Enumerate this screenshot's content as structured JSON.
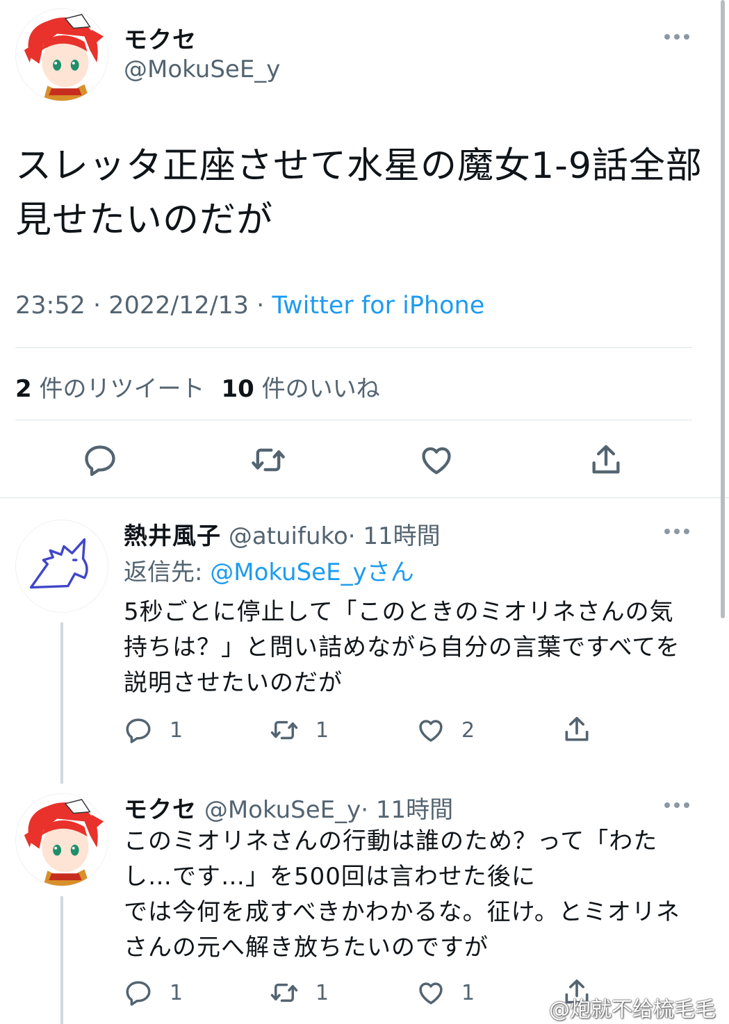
{
  "main_tweet": {
    "name": "モクセ",
    "handle": "@MokuSeE_y",
    "text": "スレッタ正座させて水星の魔女1-9話全部見せたいのだが",
    "time": "23:52",
    "date": "2022/12/13",
    "separator": "·",
    "source": "Twitter for iPhone",
    "retweets_count": "2",
    "retweets_label": "件のリツイート",
    "likes_count": "10",
    "likes_label": "件のいいね"
  },
  "replies": [
    {
      "name": "熱井風子",
      "handle": "@atuifuko",
      "time": "· 11時間",
      "reply_to_prefix": "返信先: ",
      "reply_to_mention": "@MokuSeE_y",
      "reply_to_suffix": "さん",
      "text": "5秒ごとに停止して「このときのミオリネさんの気持ちは？」と問い詰めながら自分の言葉ですべてを説明させたいのだが",
      "reply_count": "1",
      "retweet_count": "1",
      "like_count": "2"
    },
    {
      "name": "モクセ",
      "handle": "@MokuSeE_y",
      "time": "· 11時間",
      "text_line1": "このミオリネさんの行動は誰のため？って「わたし…です…」を500回は言わせた後に",
      "text_line2": "では今何を成すべきかわかるな。征け。とミオリネさんの元へ解き放ちたいのですが",
      "reply_count": "1",
      "retweet_count": "1",
      "like_count": "1"
    }
  ],
  "icons": {
    "more": "more-horizontal-icon",
    "reply": "reply-bubble-icon",
    "retweet": "retweet-icon",
    "like": "heart-icon",
    "share": "share-upload-icon"
  },
  "colors": {
    "link": "#1d9bf0",
    "secondary_text": "#536471",
    "avatar_hair": "#e8322b",
    "unicorn": "#4046c8"
  },
  "watermark": "@炮就不给梳毛毛"
}
